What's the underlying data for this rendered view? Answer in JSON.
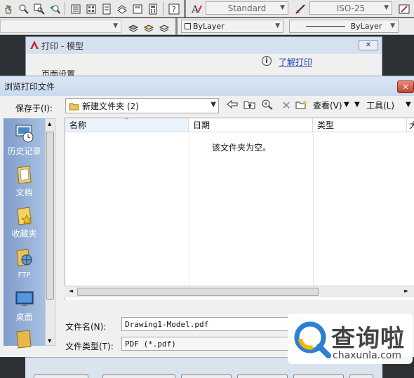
{
  "toolbar": {
    "text_style": "Standard",
    "dim_style": "ISO-25",
    "layer_color": "ByLayer",
    "linetype": "ByLayer"
  },
  "print_dialog": {
    "title": "打印 - 模型",
    "help_link": "了解打印",
    "section_partial": "页面设置"
  },
  "browse": {
    "title": "浏览打印文件",
    "save_in_label": "保存于(I):",
    "folder_name": "新建文件夹 (2)",
    "view_label": "查看(V)",
    "tools_label": "工具(L)",
    "sidebar": [
      {
        "label": "历史记录",
        "icon": "history-icon"
      },
      {
        "label": "文档",
        "icon": "documents-icon"
      },
      {
        "label": "收藏夹",
        "icon": "favorites-icon"
      },
      {
        "label": "FTP",
        "icon": "ftp-icon"
      },
      {
        "label": "桌面",
        "icon": "desktop-icon"
      }
    ],
    "columns": [
      "名称",
      "日期",
      "类型",
      "大"
    ],
    "empty_message": "该文件夹为空。",
    "filename_label": "文件名(N):",
    "filename_value": "Drawing1-Model.pdf",
    "filetype_label": "文件类型(T):",
    "filetype_value": "PDF (*.pdf)"
  },
  "watermark": {
    "brand": "查询啦",
    "url": "chaxunla.com"
  },
  "colors": {
    "sidebar_gradient_start": "#7f9cc9",
    "sidebar_gradient_end": "#a8c0e2",
    "close_red": "#c2452f",
    "link_blue": "#1a3faa"
  }
}
